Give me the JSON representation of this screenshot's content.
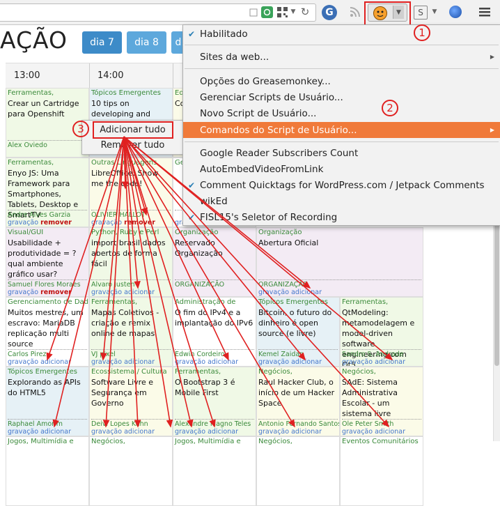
{
  "toolbar": {
    "icons": [
      "reload-icon",
      "qr-code-icon",
      "dropdown-icon",
      "refresh-icon",
      "g-icon",
      "rss-icon",
      "greasemonkey-icon",
      "dropdown-icon",
      "s-icon",
      "globe-icon",
      "menu-icon"
    ],
    "annotation_1": "1"
  },
  "page": {
    "title": "AÇÃO",
    "days": [
      "dia 7",
      "dia 8",
      "d"
    ],
    "times": [
      "13:00",
      "14:00"
    ]
  },
  "grid": {
    "rows": [
      [
        {
          "cat": "Ferramentas,",
          "title": "Crear un Cartridge para Openshift",
          "author": "Alex Oviedo",
          "rec": "",
          "remove": false,
          "color": "green"
        },
        {
          "cat": "Tópicos Emergentes",
          "title": "10 tips on developing and deploying large",
          "author": "",
          "rec": "",
          "remove": false,
          "color": "blue"
        },
        {
          "cat": "Ed",
          "title": "Co Be",
          "author": "",
          "rec": "",
          "remove": false,
          "color": "yellow"
        }
      ],
      [
        {
          "cat": "Ferramentas,",
          "title": "Enyo JS: Uma Framework para Smartphones, Tablets, Desktop e SmartTV",
          "author": "Andre Alves Garzia",
          "rec": "gravação",
          "remove": true,
          "color": "green"
        },
        {
          "cat": "Outras Linguagens",
          "title": "LibreOffice: Show me the code!",
          "author": "OLIVIER HALLOT",
          "rec": "gravação",
          "remove": true,
          "color": "yellow"
        },
        {
          "cat": "Ge",
          "title": "",
          "author": "",
          "rec": "gravação adicionar",
          "remove": false,
          "color": "white"
        }
      ],
      [
        {
          "cat": "Visual/GUI",
          "title": "Usabilidade + produtividade = ? qual ambiente gráfico usar?",
          "author": "Samuel Flores Moraes",
          "rec": "gravação",
          "remove": true,
          "color": "purple"
        },
        {
          "cat": "Python, Ruby e Perl",
          "title": "import brasil dados abertos de forma fácil",
          "author": "Alvaro Justen",
          "rec": "gravação adicionar",
          "remove": false,
          "color": "green"
        },
        {
          "cat": "Organização",
          "title": "Reservado Organização",
          "author": "ORGANIZAÇÃO",
          "rec": "",
          "remove": false,
          "color": "purple"
        },
        {
          "cat": "Organização",
          "title": "Abertura Oficial",
          "author": "ORGANIZAÇÃO",
          "rec": "gravação adicionar",
          "remove": false,
          "color": "purple"
        }
      ],
      [
        {
          "cat": "Gerenciamento de Dados",
          "title": "Muitos mestres, um escravo: MariaDB replicação multi source",
          "author": "Carlos Pirez",
          "rec": "gravação adicionar",
          "remove": false,
          "color": "white"
        },
        {
          "cat": "Ferramentas,",
          "title": "Mapas Coletivos - criação e remix online de mapas",
          "author": "VJ pixel",
          "rec": "gravação adicionar",
          "remove": false,
          "color": "green"
        },
        {
          "cat": "Administração de",
          "title": "O fim do IPv4 e a implantação do IPv6",
          "author": "Edwin Cordeiro",
          "rec": "gravação adicionar",
          "remove": false,
          "color": "white"
        },
        {
          "cat": "Tópicos Emergentes",
          "title": "Bitcoin, o futuro do dinheiro é open source (e livre)",
          "author": "Kemel Zaidan",
          "rec": "gravação adicionar",
          "remove": false,
          "color": "blue"
        },
        {
          "cat": "Ferramentas,",
          "title": "QtModeling: metamodelagem e model-driven software engineering com Qt5",
          "author": "Sandro S. Andrade",
          "rec": "gravação adicionar",
          "remove": false,
          "color": "green"
        }
      ],
      [
        {
          "cat": "Tópicos Emergentes",
          "title": "Explorando as APIs do HTML5",
          "author": "Raphael Amorim",
          "rec": "gravação adicionar",
          "remove": false,
          "color": "blue"
        },
        {
          "cat": "Ecossistema / Cultura",
          "title": "Software Livre e Segurança em Governo",
          "author": "Deivi Lopes Kuhn",
          "rec": "gravação adicionar",
          "remove": false,
          "color": "yellow"
        },
        {
          "cat": "Ferramentas,",
          "title": "O Bootstrap 3 é Mobile First",
          "author": "Alexandre Magno Teles",
          "rec": "gravação adicionar",
          "remove": false,
          "color": "green"
        },
        {
          "cat": "Negócios,",
          "title": "Raul Hacker Club, o início de um Hacker Space",
          "author": "Antonio Fernando Santos",
          "rec": "gravação adicionar",
          "remove": false,
          "color": "yellow"
        },
        {
          "cat": "Negócios,",
          "title": "SAdE: Sistema Administrativa Escolar - um sistema livre",
          "author": "Ole Peter Smith",
          "rec": "gravação adicionar",
          "remove": false,
          "color": "yellow"
        }
      ],
      [
        {
          "cat": "Jogos, Multimídia e",
          "title": "",
          "author": "",
          "rec": "",
          "remove": false,
          "color": "white"
        },
        {
          "cat": "Negócios,",
          "title": "",
          "author": "",
          "rec": "",
          "remove": false,
          "color": "white"
        },
        {
          "cat": "Jogos, Multimídia e",
          "title": "",
          "author": "",
          "rec": "",
          "remove": false,
          "color": "white"
        },
        {
          "cat": "Negócios,",
          "title": "",
          "author": "",
          "rec": "",
          "remove": false,
          "color": "white"
        },
        {
          "cat": "Eventos Comunitários",
          "title": "",
          "author": "",
          "rec": "",
          "remove": false,
          "color": "white"
        }
      ]
    ]
  },
  "popup": {
    "add_label": "Adicionar tudo",
    "remove_label": "Remover tudo",
    "annotation_3": "3"
  },
  "menu": {
    "items": [
      {
        "label": "Habilitado",
        "checked": true,
        "submenu": false
      },
      {
        "label": "Sites da web...",
        "checked": false,
        "submenu": true
      },
      {
        "label": "Opções do Greasemonkey...",
        "checked": false,
        "submenu": false
      },
      {
        "label": "Gerenciar Scripts de Usuário...",
        "checked": false,
        "submenu": false
      },
      {
        "label": "Novo Script de Usuário...",
        "checked": false,
        "submenu": false
      },
      {
        "label": "Comandos do Script de Usuário...",
        "checked": false,
        "submenu": true,
        "highlighted": true
      },
      {
        "label": "Google Reader Subscribers Count",
        "checked": false,
        "submenu": false
      },
      {
        "label": "AutoEmbedVideoFromLink",
        "checked": false,
        "submenu": false
      },
      {
        "label": "Comment Quicktags for WordPress.com / Jetpack Comments",
        "checked": true,
        "submenu": false
      },
      {
        "label": "wikEd",
        "checked": false,
        "submenu": false
      },
      {
        "label": "FISL15's Seletor of Recording",
        "checked": true,
        "submenu": false
      }
    ],
    "annotation_2": "2"
  },
  "colors": {
    "accent": "#3d8bc8",
    "menu_highlight": "#f07a3a",
    "annotation": "#e02020",
    "category_green": "#3a8a3a",
    "record_blue": "#4477cc"
  }
}
